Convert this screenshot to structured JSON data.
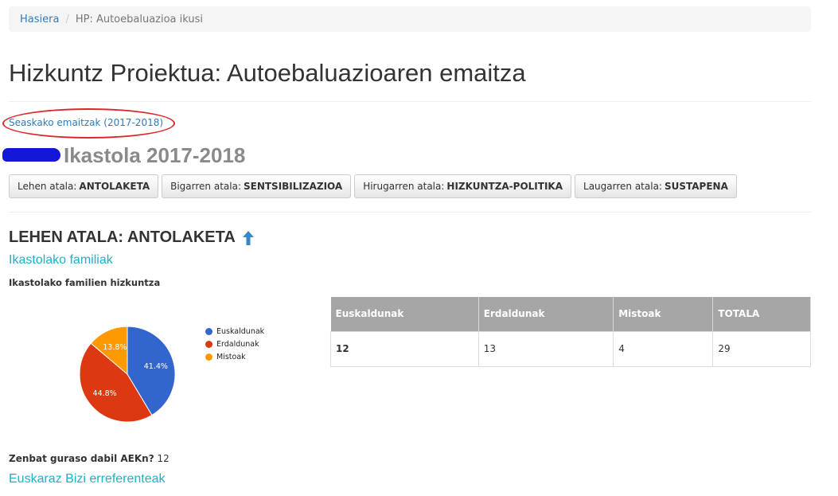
{
  "breadcrumb": {
    "home": "Hasiera",
    "separator": "/",
    "current": "HP: Autoebaluazioa ikusi"
  },
  "page_title": "Hizkuntz Proiektua: Autoebaluazioaren emaitza",
  "season_link": "Seaskako emaitzak (2017-2018)",
  "school_title": "Ikastola 2017-2018",
  "sections": [
    {
      "prefix": "Lehen atala:",
      "name": "ANTOLAKETA"
    },
    {
      "prefix": "Bigarren atala:",
      "name": "SENTSIBILIZAZIOA"
    },
    {
      "prefix": "Hirugarren atala:",
      "name": "HIZKUNTZA-POLITIKA"
    },
    {
      "prefix": "Laugarren atala:",
      "name": "SUSTAPENA"
    }
  ],
  "section_heading": "LEHEN ATALA: ANTOLAKETA",
  "subsection_link": "Ikastolako familiak",
  "subsection_title": "Ikastolako familien hizkuntza",
  "chart_data": {
    "type": "pie",
    "categories": [
      "Euskaldunak",
      "Erdaldunak",
      "Mistoak"
    ],
    "values": [
      41.4,
      44.8,
      13.8
    ],
    "labels": [
      "41.4%",
      "44.8%",
      "13.8%"
    ],
    "colors": [
      "#3366cc",
      "#dc3912",
      "#ff9900"
    ],
    "legend": "right"
  },
  "table": {
    "headers": [
      "Euskaldunak",
      "Erdaldunak",
      "Mistoak",
      "TOTALA"
    ],
    "row": [
      "12",
      "13",
      "4",
      "29"
    ]
  },
  "question": {
    "label": "Zenbat guraso dabil AEKn?",
    "value": "12"
  },
  "bottom_link": "Euskaraz Bizi erreferenteak",
  "icons": {
    "arrow": "arrow-up-icon"
  }
}
